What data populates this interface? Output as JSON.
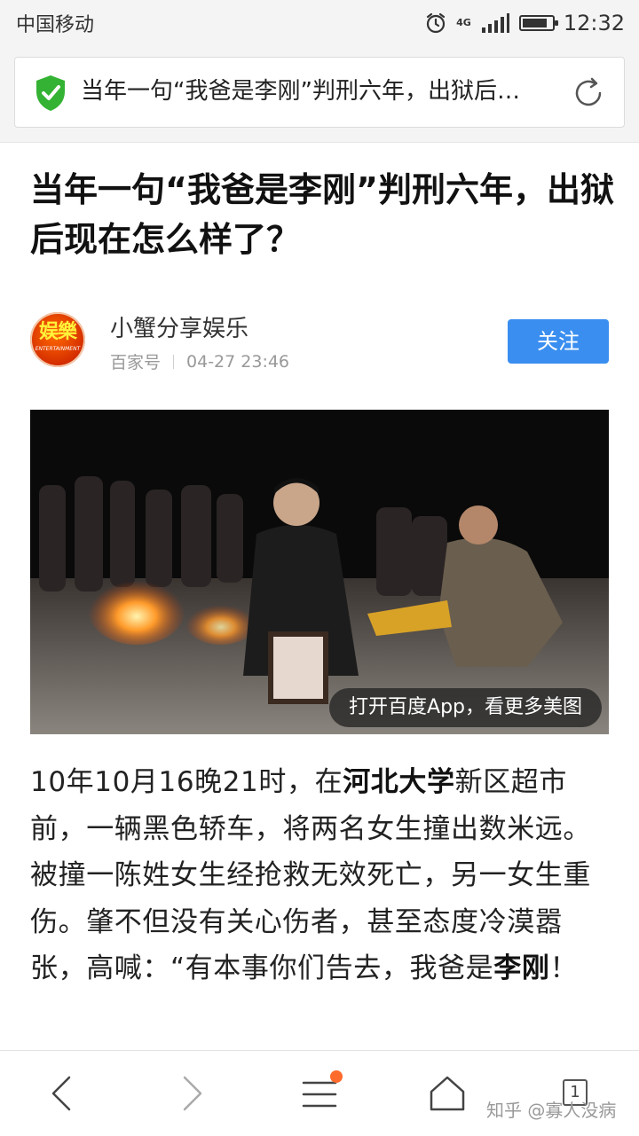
{
  "status_bar": {
    "carrier": "中国移动",
    "network": "4G",
    "time": "12:32",
    "battery_level": 0.85
  },
  "address_bar": {
    "title": "当年一句“我爸是李刚”判刑六年，出狱后…",
    "secure_icon": "shield-check-icon",
    "reload_icon": "refresh-icon"
  },
  "article": {
    "headline": "当年一句“我爸是李刚”判刑六年，出狱后现在怎么样了？",
    "author": {
      "name": "小蟹分享娱乐",
      "avatar_text": "娱樂",
      "avatar_subtext": "ENTERTAINMENT",
      "source": "百家号",
      "date": "04-27 23:46"
    },
    "follow_label": "关注",
    "image": {
      "hint": "打开百度App，看更多美图"
    },
    "body": {
      "p1_prefix": "10年10月16晚21时，在",
      "p1_bold": "河北大学",
      "p1_mid": "新区超市前，一辆黑色轿车，将两名女生撞出数米远。被撞一陈姓女生经抢救无效死亡，另一女生重伤。肇不但没有关心伤者，甚至态度冷漠嚣张，高喊：“有本事你们告去，我爸是",
      "p1_bold2": "李刚",
      "p1_suffix": "！"
    }
  },
  "bottom_nav": {
    "back_icon": "chevron-left-icon",
    "forward_icon": "chevron-right-icon",
    "menu_icon": "menu-icon",
    "home_icon": "home-icon",
    "tabs_count": "1",
    "watermark": "知乎 @寡人没病"
  },
  "colors": {
    "accent": "#3a8ef0",
    "secure": "#34b233",
    "notify": "#ff6b2c"
  }
}
